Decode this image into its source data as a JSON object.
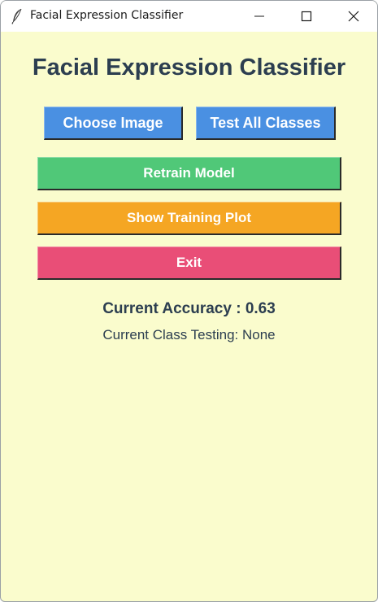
{
  "window": {
    "title": "Facial Expression Classifier",
    "icon": "feather-icon",
    "controls": [
      "minimize-icon",
      "maximize-icon",
      "close-icon"
    ]
  },
  "main": {
    "heading": "Facial Expression Classifier",
    "buttons": {
      "choose_image": "Choose Image",
      "test_all_classes": "Test All Classes",
      "retrain_model": "Retrain Model",
      "show_training_plot": "Show Training Plot",
      "exit": "Exit"
    },
    "accuracy_text": "Current Accuracy : 0.63",
    "class_testing_text": "Current Class Testing: None"
  },
  "colors": {
    "background": "#fafccd",
    "title_text": "#2c3e50",
    "blue_button": "#4a90e2",
    "green_button": "#50c878",
    "orange_button": "#f5a623",
    "red_button": "#e94e77"
  }
}
